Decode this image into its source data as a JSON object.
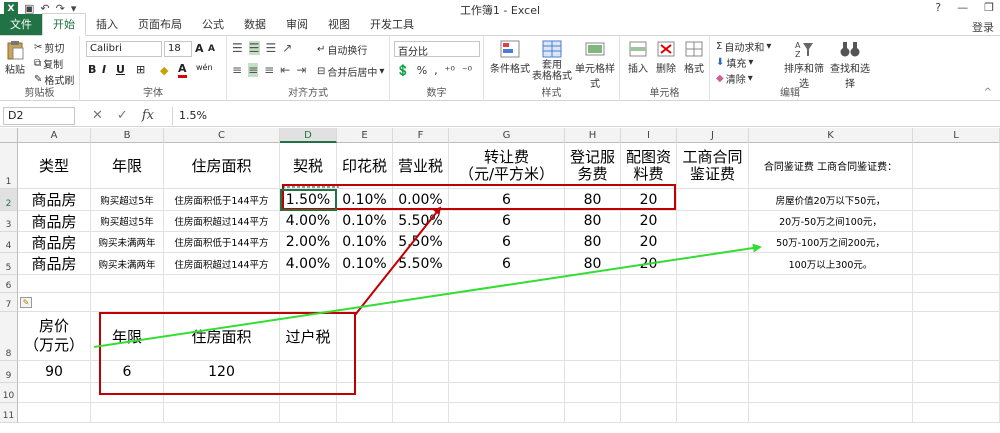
{
  "window": {
    "title": "工作簿1 - Excel",
    "help": "?",
    "minimize": "—",
    "restore": "❐",
    "login": "登录"
  },
  "tabs": [
    "文件",
    "开始",
    "插入",
    "页面布局",
    "公式",
    "数据",
    "审阅",
    "视图",
    "开发工具"
  ],
  "ribbon": {
    "clipboard": {
      "label": "剪贴板",
      "paste": "粘贴",
      "cut": "剪切",
      "copy": "复制",
      "format_painter": "格式刷"
    },
    "font": {
      "label": "字体",
      "font_name": "Calibri",
      "font_size": "18",
      "grow": "A",
      "shrink": "A",
      "bold": "B",
      "italic": "I",
      "underline": "U",
      "wen": "wén",
      "color_a": "A"
    },
    "alignment": {
      "label": "对齐方式",
      "wrap": "自动换行",
      "merge": "合并后居中"
    },
    "number": {
      "label": "数字",
      "format": "百分比",
      "pct": "%",
      "comma": ","
    },
    "styles": {
      "label": "样式",
      "conditional": "条件格式",
      "table": "套用\n表格格式",
      "cell_styles": "单元格样式"
    },
    "cells": {
      "label": "单元格",
      "insert": "插入",
      "delete": "删除",
      "format": "格式"
    },
    "editing": {
      "label": "编辑",
      "autosum": "自动求和",
      "fill": "填充",
      "clear": "清除",
      "sort": "排序和筛选",
      "find": "查找和选择"
    }
  },
  "formula_bar": {
    "name_box": "D2",
    "fx": "fx",
    "value": "1.5%"
  },
  "columns": [
    "A",
    "B",
    "C",
    "D",
    "E",
    "F",
    "G",
    "H",
    "I",
    "J",
    "K",
    "L"
  ],
  "rows": [
    "1",
    "2",
    "3",
    "4",
    "5",
    "6",
    "7",
    "8",
    "9",
    "10",
    "11"
  ],
  "cells": {
    "header": {
      "A": "类型",
      "B": "年限",
      "C": "住房面积",
      "D": "契税",
      "E": "印花税",
      "F": "营业税",
      "G": "转让费\n（元/平方米）",
      "H": "登记服\n务费",
      "I": "配图资\n料费",
      "J": "工商合同\n鉴证费",
      "K": "合同鉴证费 工商合同鉴证费："
    },
    "data": [
      {
        "A": "商品房",
        "B": "购买超过5年",
        "C": "住房面积低于144平方",
        "D": "1.50%",
        "E": "0.10%",
        "F": "0.00%",
        "G": "6",
        "H": "80",
        "I": "20",
        "K": "房屋价值20万以下50元，"
      },
      {
        "A": "商品房",
        "B": "购买超过5年",
        "C": "住房面积超过144平方",
        "D": "4.00%",
        "E": "0.10%",
        "F": "5.50%",
        "G": "6",
        "H": "80",
        "I": "20",
        "K": "20万-50万之间100元，"
      },
      {
        "A": "商品房",
        "B": "购买未满两年",
        "C": "住房面积低于144平方",
        "D": "2.00%",
        "E": "0.10%",
        "F": "5.50%",
        "G": "6",
        "H": "80",
        "I": "20",
        "K": "50万-100万之间200元，"
      },
      {
        "A": "商品房",
        "B": "购买未满两年",
        "C": "住房面积超过144平方",
        "D": "4.00%",
        "E": "0.10%",
        "F": "5.50%",
        "G": "6",
        "H": "80",
        "I": "20",
        "K": "100万以上300元。"
      }
    ],
    "row8": {
      "A": "房价\n（万元）",
      "B": "年限",
      "C": "住房面积",
      "D": "过户税"
    },
    "row9": {
      "A": "90",
      "B": "6",
      "C": "120"
    }
  },
  "colors": {
    "excel_green": "#217346",
    "annotation_red": "#c00000",
    "annotation_green": "#33dd33"
  }
}
